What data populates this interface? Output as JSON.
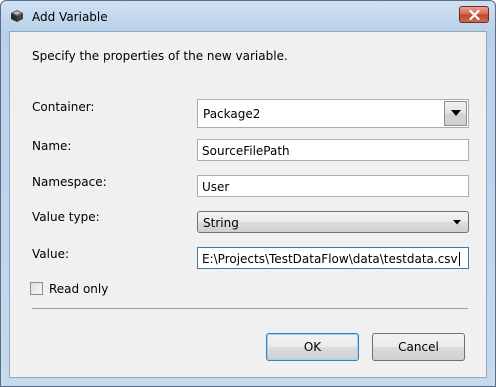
{
  "window": {
    "title": "Add Variable",
    "close_icon": "close-x-icon",
    "app_icon": "ssis-cube-icon"
  },
  "form": {
    "instructions": "Specify the properties of the new variable.",
    "container": {
      "label": "Container:",
      "value": "Package2"
    },
    "name": {
      "label": "Name:",
      "value": "SourceFilePath"
    },
    "namespace": {
      "label": "Namespace:",
      "value": "User"
    },
    "value_type": {
      "label": "Value type:",
      "value": "String"
    },
    "value": {
      "label": "Value:",
      "value": "E:\\Projects\\TestDataFlow\\data\\testdata.csv"
    },
    "read_only": {
      "label": "Read only",
      "checked": false
    }
  },
  "buttons": {
    "ok": "OK",
    "cancel": "Cancel"
  },
  "colors": {
    "title_bar": "#b9d1ea",
    "close_button": "#c0432a",
    "dialog_body": "#f0f0f0",
    "default_button_border": "#3c7fb1"
  }
}
